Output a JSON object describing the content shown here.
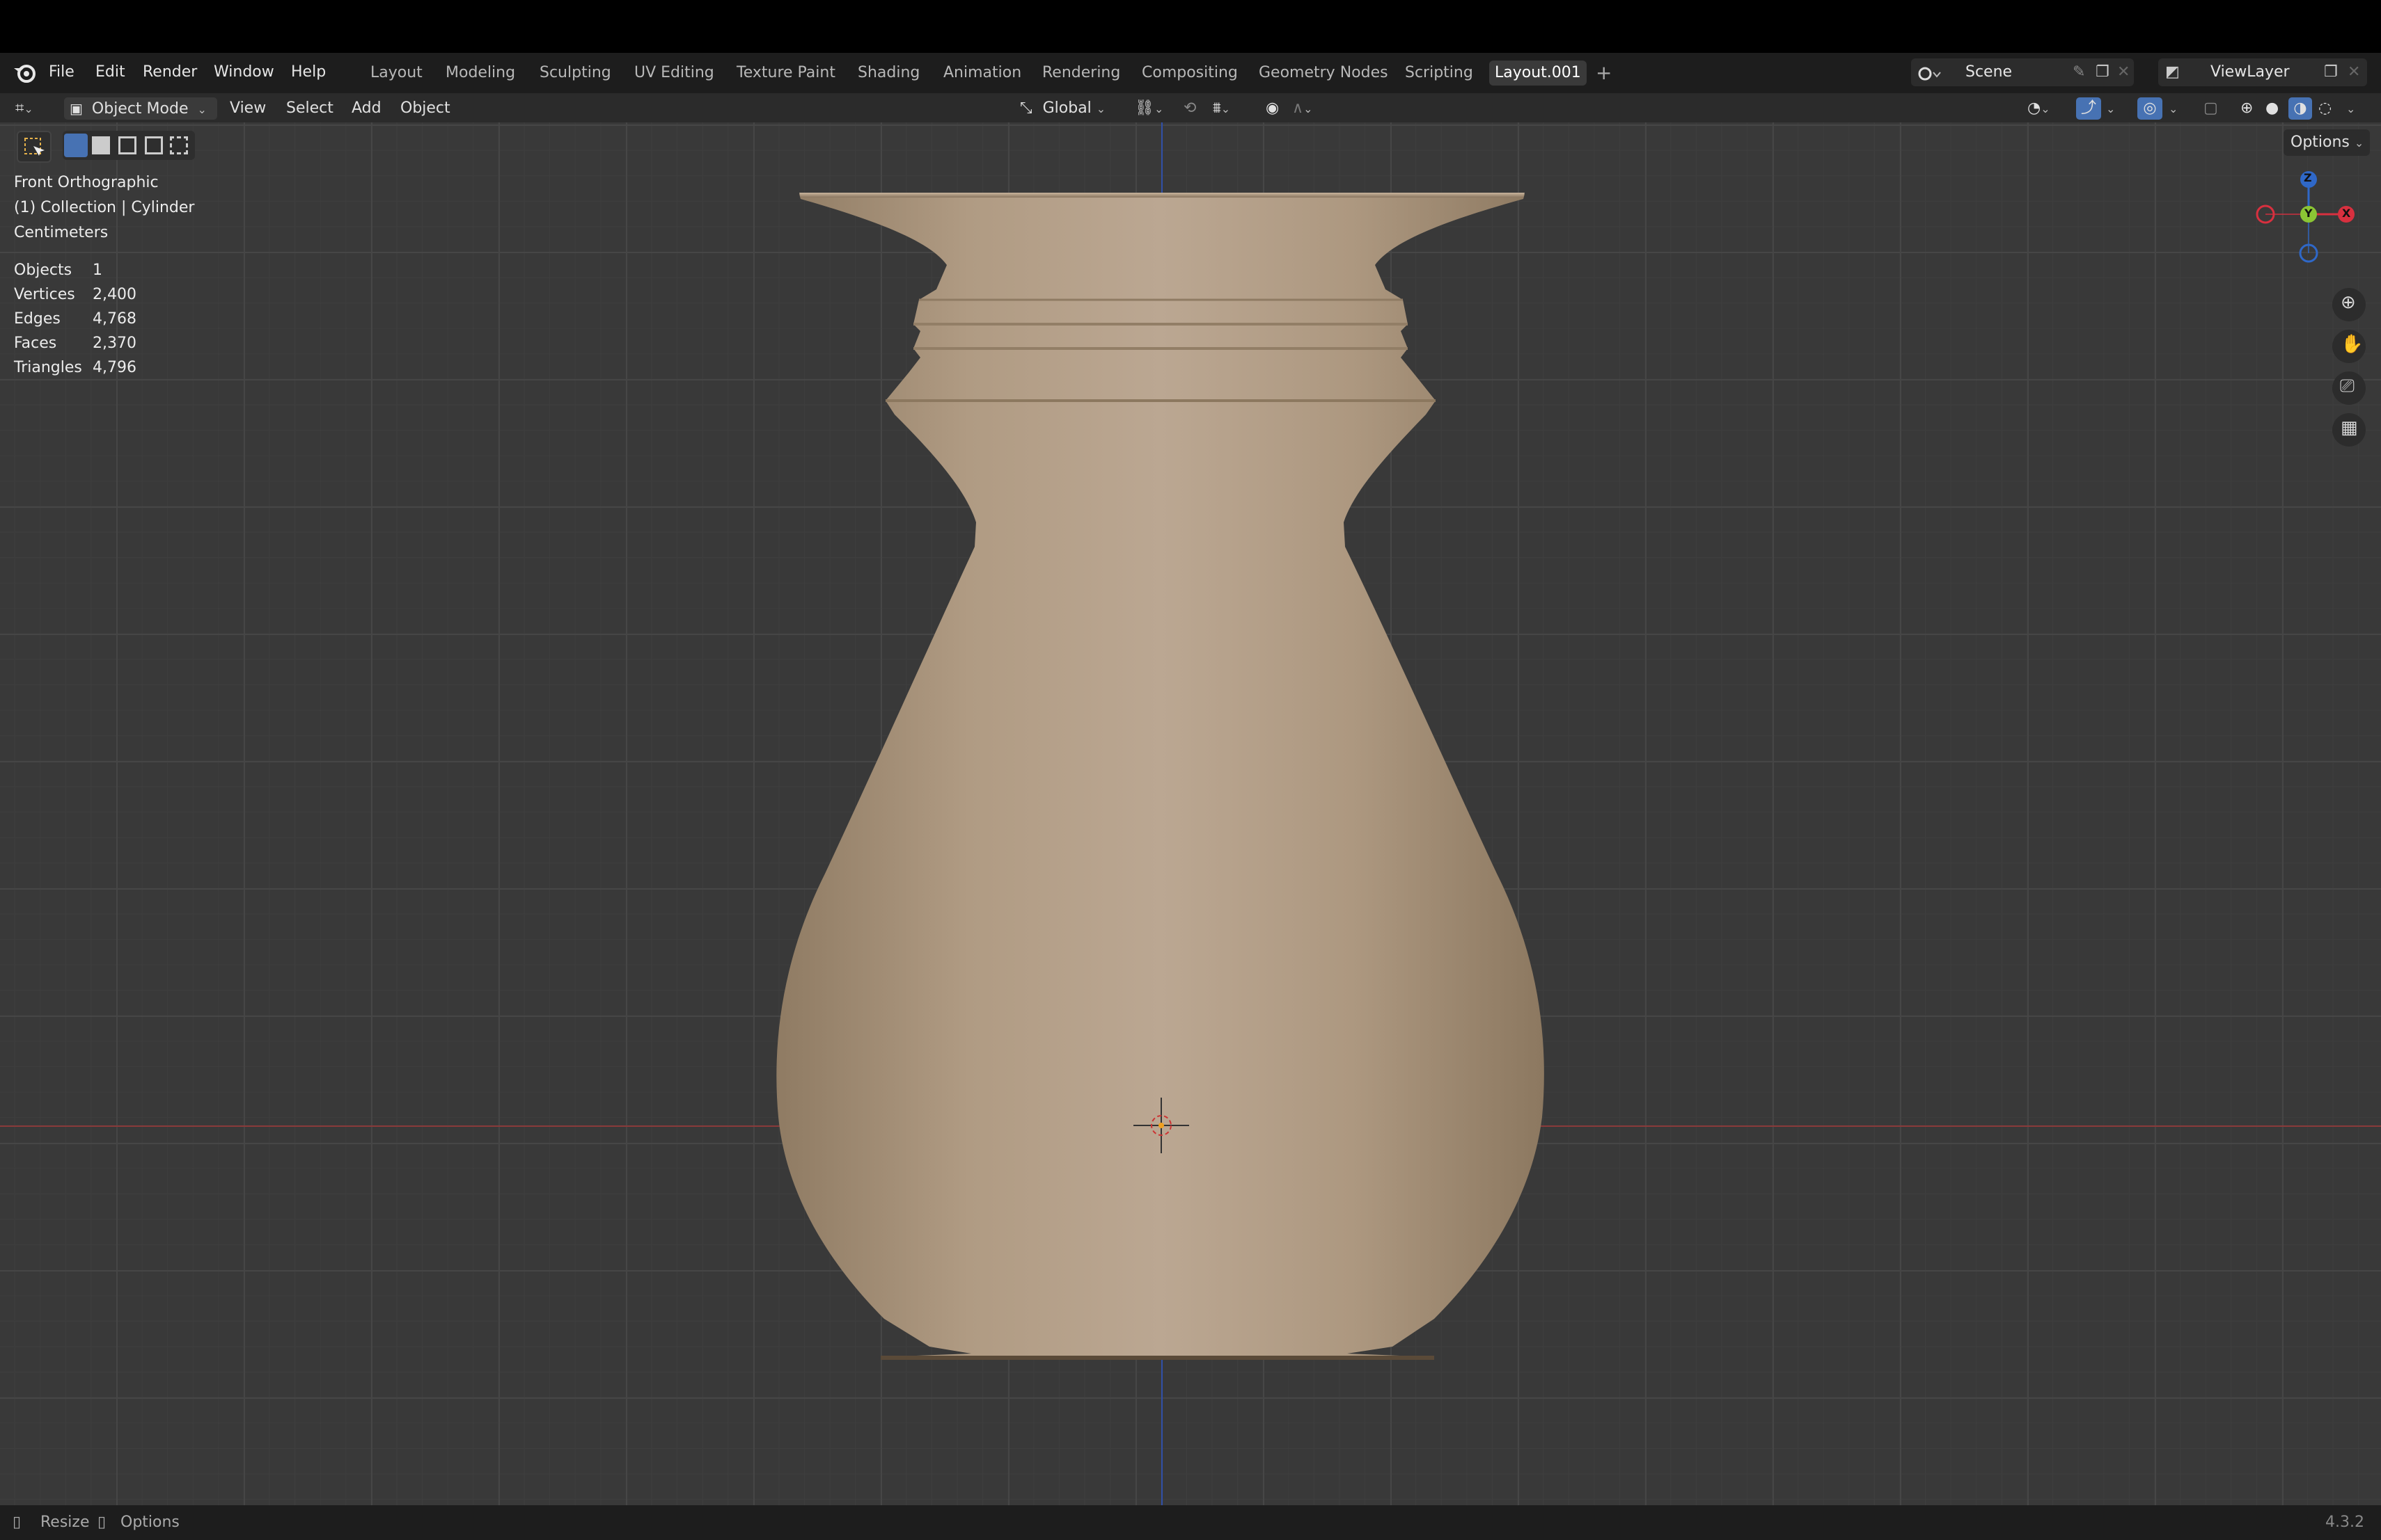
{
  "menu": {
    "file": "File",
    "edit": "Edit",
    "render": "Render",
    "window": "Window",
    "help": "Help"
  },
  "workspaces": [
    "Layout",
    "Modeling",
    "Sculpting",
    "UV Editing",
    "Texture Paint",
    "Shading",
    "Animation",
    "Rendering",
    "Compositing",
    "Geometry Nodes",
    "Scripting",
    "Layout.001"
  ],
  "active_workspace": "Layout.001",
  "scene_name": "Scene",
  "view_layer": "ViewLayer",
  "header": {
    "mode": "Object Mode",
    "view": "View",
    "select": "Select",
    "add": "Add",
    "object": "Object",
    "transform_orientation": "Global",
    "options": "Options"
  },
  "viewport_info": {
    "view_name": "Front Orthographic",
    "collection": "(1) Collection | Cylinder",
    "units": "Centimeters"
  },
  "stats": [
    {
      "label": "Objects",
      "value": "1"
    },
    {
      "label": "Vertices",
      "value": "2,400"
    },
    {
      "label": "Edges",
      "value": "4,768"
    },
    {
      "label": "Faces",
      "value": "2,370"
    },
    {
      "label": "Triangles",
      "value": "4,796"
    }
  ],
  "gizmo": {
    "z": "Z",
    "y": "Y",
    "x": "X"
  },
  "status": {
    "resize": "Resize",
    "options": "Options",
    "version": "4.3.2"
  },
  "colors": {
    "accent_blue": "#4772b3",
    "axis_x": "#d8303f",
    "axis_y": "#8bc534",
    "axis_z": "#2f68c8",
    "vase": "#b8a58e"
  },
  "icons": [
    "blender-logo-icon",
    "editor-type-icon",
    "object-mode-icon",
    "select-box-icon",
    "transform-orientation-icon",
    "pivot-icon",
    "snap-icon",
    "proportional-edit-icon",
    "visibility-icon",
    "gizmo-icon",
    "overlay-icon",
    "xray-icon",
    "shading-wireframe-icon",
    "shading-solid-icon",
    "shading-material-icon",
    "shading-rendered-icon",
    "zoom-icon",
    "pan-hand-icon",
    "camera-icon",
    "grid-icon",
    "3d-cursor-icon",
    "add-workspace-icon",
    "pin-icon",
    "new-scene-icon",
    "close-icon"
  ]
}
